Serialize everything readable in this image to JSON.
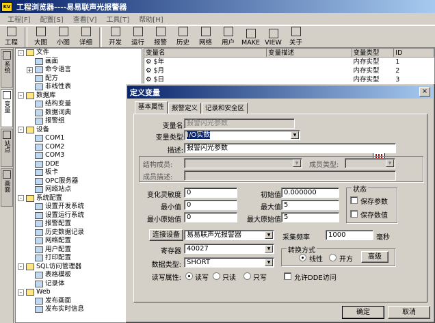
{
  "app": {
    "title": "工程浏览器----易易联声光报警器"
  },
  "menu": [
    "工程[F]",
    "配置[S]",
    "查看[V]",
    "工具[T]",
    "帮助[H]"
  ],
  "toolbar": {
    "g1": [
      "工程"
    ],
    "g2": [
      "大图",
      "小图",
      "详细"
    ],
    "g3": [
      "开发",
      "运行",
      "报警",
      "历史",
      "网络",
      "用户",
      "MAKE",
      "VIEW",
      "关于"
    ]
  },
  "sidetabs": [
    "系统",
    "变量",
    "站点",
    "画面"
  ],
  "tree": [
    {
      "t": "文件",
      "l": 0,
      "e": "-"
    },
    {
      "t": "画面",
      "l": 1
    },
    {
      "t": "命令语言",
      "l": 1,
      "e": "+"
    },
    {
      "t": "配方",
      "l": 1
    },
    {
      "t": "非线性表",
      "l": 1
    },
    {
      "t": "数据库",
      "l": 0,
      "e": "-"
    },
    {
      "t": "结构变量",
      "l": 1
    },
    {
      "t": "数据词典",
      "l": 1
    },
    {
      "t": "报警组",
      "l": 1
    },
    {
      "t": "设备",
      "l": 0,
      "e": "-"
    },
    {
      "t": "COM1",
      "l": 1
    },
    {
      "t": "COM2",
      "l": 1
    },
    {
      "t": "COM3",
      "l": 1
    },
    {
      "t": "DDE",
      "l": 1
    },
    {
      "t": "板卡",
      "l": 1
    },
    {
      "t": "OPC服务器",
      "l": 1
    },
    {
      "t": "网络站点",
      "l": 1
    },
    {
      "t": "系统配置",
      "l": 0,
      "e": "-"
    },
    {
      "t": "设置开发系统",
      "l": 1
    },
    {
      "t": "设置运行系统",
      "l": 1
    },
    {
      "t": "报警配置",
      "l": 1
    },
    {
      "t": "历史数据记录",
      "l": 1
    },
    {
      "t": "网络配置",
      "l": 1
    },
    {
      "t": "用户配置",
      "l": 1
    },
    {
      "t": "打印配置",
      "l": 1
    },
    {
      "t": "SQL访问管理器",
      "l": 0,
      "e": "-"
    },
    {
      "t": "表格模板",
      "l": 1
    },
    {
      "t": "记录体",
      "l": 1
    },
    {
      "t": "Web",
      "l": 0,
      "e": "-"
    },
    {
      "t": "发布画面",
      "l": 1
    },
    {
      "t": "发布实时信息",
      "l": 1
    }
  ],
  "list": {
    "headers": [
      "变量名",
      "变量描述",
      "变量类型",
      "ID"
    ],
    "rows": [
      [
        "$年",
        "",
        "内存实型",
        "1"
      ],
      [
        "$月",
        "",
        "内存实型",
        "2"
      ],
      [
        "$日",
        "",
        "内存实型",
        "3"
      ]
    ]
  },
  "dialog": {
    "title": "定义变量",
    "close": "×",
    "tabs": [
      "基本属性",
      "报警定义",
      "记录和安全区"
    ],
    "labels": {
      "var_name": "变量名:",
      "var_type": "变量类型:",
      "desc": "描述:",
      "struct_member": "结构成员:",
      "member_type": "成员类型:",
      "member_desc": "成员描述:",
      "sensitivity": "变化灵敏度",
      "min": "最小值",
      "min_raw": "最小原始值",
      "init": "初始值",
      "max": "最大值",
      "max_raw": "最大原始值",
      "state": "状态",
      "keep_param": "保存参数",
      "keep_value": "保存数值",
      "device_btn": "连接设备",
      "sample": "采集频率",
      "ms": "毫秒",
      "register": "寄存器",
      "datatype": "数据类型:",
      "rw": "读写属性:",
      "conversion": "转换方式",
      "linear": "线性",
      "sqrt": "开方",
      "advanced": "高级",
      "read_write": "读写",
      "read_only": "只读",
      "write_only": "只写",
      "allow_dde": "允许DDE访问"
    },
    "values": {
      "var_name": "报警闪光参数",
      "var_type": "I/O实数",
      "desc": "报警闪光参数",
      "sensitivity": "0",
      "min": "0",
      "min_raw": "0",
      "init": "0.000000",
      "max": "5",
      "max_raw": "5",
      "device": "易易联声光报警器",
      "sample": "1000",
      "register": "40027",
      "datatype": "SHORT"
    },
    "ok": "确定",
    "cancel": "取消"
  }
}
